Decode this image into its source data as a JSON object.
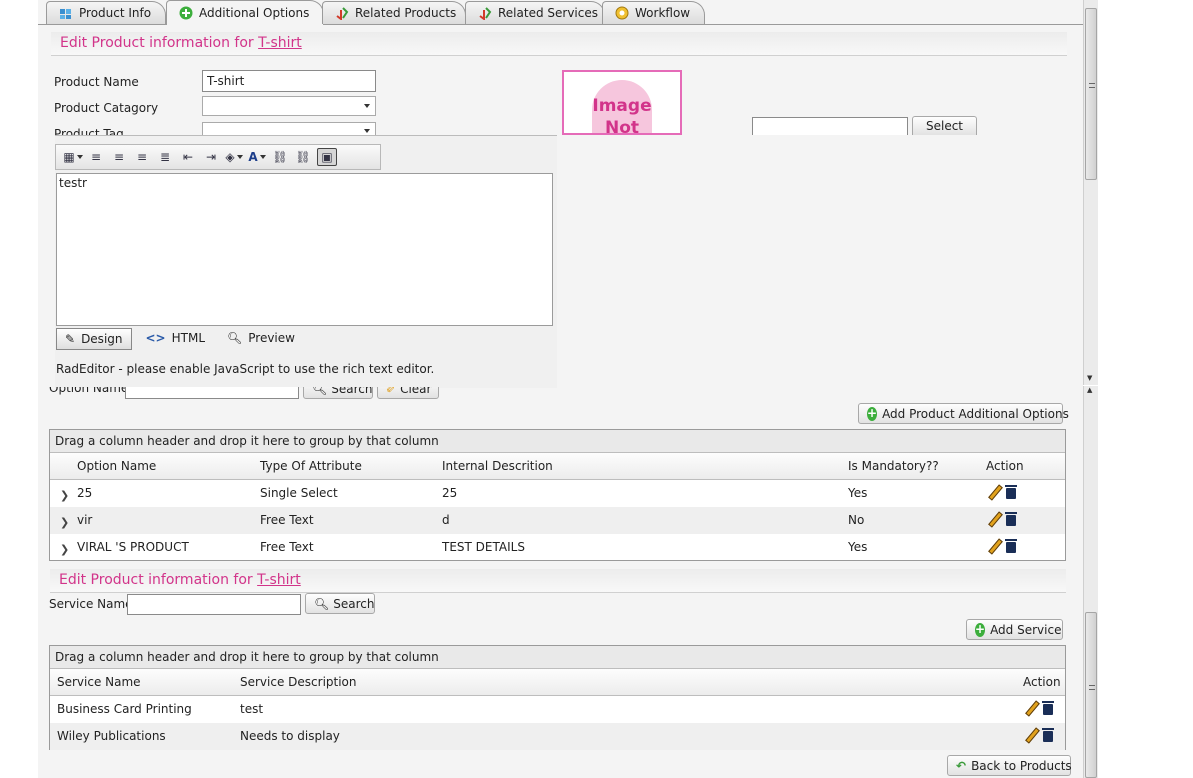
{
  "tabs": [
    {
      "label": "Product Info",
      "icon": "puzzle-icon"
    },
    {
      "label": "Additional Options",
      "icon": "plus-circle-icon"
    },
    {
      "label": "Related Products",
      "icon": "related-arrows-icon"
    },
    {
      "label": "Related Services",
      "icon": "related-arrows-icon"
    },
    {
      "label": "Workflow",
      "icon": "workflow-gear-icon"
    }
  ],
  "active_tab": "Additional Options",
  "product_section": {
    "heading_prefix": "Edit Product information for",
    "product_link": "T-shirt",
    "product_name_label": "Product Name",
    "product_name_value": "T-shirt",
    "category_label": "Product Catagory",
    "category_value": "",
    "tag_label": "Product Tag",
    "select_button": "Select",
    "image_text_1": "Image",
    "image_text_2": "Not"
  },
  "editor": {
    "content": "testr",
    "modes": [
      {
        "label": "Design",
        "icon": "pencil-icon"
      },
      {
        "label": "HTML",
        "icon": "code-brackets-icon"
      },
      {
        "label": "Preview",
        "icon": "magnifier-icon"
      }
    ],
    "active_mode": "Design",
    "message": "RadEditor - please enable JavaScript to use the rich text editor."
  },
  "options_filter": {
    "label": "Option Name",
    "search_button": "Search",
    "clear_button": "Clear"
  },
  "add_options_button": "Add Product Additional Options",
  "options_grid": {
    "group_hint": "Drag a column header and drop it here to group by that column",
    "columns": [
      "Option Name",
      "Type Of Attribute",
      "Internal Descrition",
      "Is Mandatory??",
      "Action"
    ],
    "rows": [
      {
        "name": "25",
        "type": "Single Select",
        "desc": "25",
        "mandatory": "Yes"
      },
      {
        "name": "vir",
        "type": "Free Text",
        "desc": "d",
        "mandatory": "No"
      },
      {
        "name": "VIRAL 'S PRODUCT",
        "type": "Free Text",
        "desc": "TEST DETAILS",
        "mandatory": "Yes"
      }
    ]
  },
  "services_section": {
    "heading_prefix": "Edit Product information for",
    "product_link": "T-shirt",
    "service_name_label": "Service Name",
    "service_name_value": "",
    "search_button": "Search",
    "add_service_button": "Add Service"
  },
  "services_grid": {
    "group_hint": "Drag a column header and drop it here to group by that column",
    "columns": [
      "Service Name",
      "Service Description",
      "Action"
    ],
    "rows": [
      {
        "name": "Business Card Printing",
        "desc": "test"
      },
      {
        "name": "Wiley Publications",
        "desc": "Needs to display"
      }
    ]
  },
  "back_button": "Back to Products",
  "colors": {
    "accent_pink": "#d2348a",
    "add_green": "#3cae3c",
    "tab_border": "#9a9a9a"
  }
}
